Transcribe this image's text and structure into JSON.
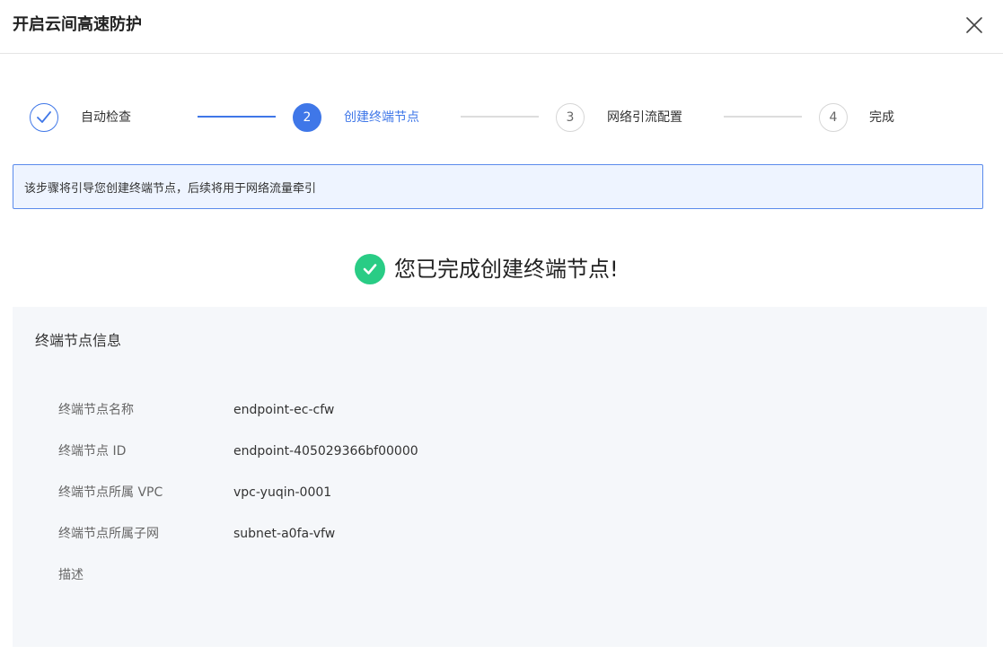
{
  "header": {
    "title": "开启云间高速防护",
    "close_icon": "close-icon"
  },
  "colors": {
    "primary": "#3f77e8",
    "success": "#29cc85",
    "banner_bg": "#eef4ff",
    "card_bg": "#f5f7fa"
  },
  "steps": [
    {
      "number": "",
      "label": "自动检查",
      "status": "done",
      "icon": "check-icon"
    },
    {
      "number": "2",
      "label": "创建终端节点",
      "status": "active"
    },
    {
      "number": "3",
      "label": "网络引流配置",
      "status": "todo"
    },
    {
      "number": "4",
      "label": "完成",
      "status": "todo"
    }
  ],
  "banner": {
    "text": "该步骤将引导您创建终端节点，后续将用于网络流量牵引"
  },
  "success": {
    "icon": "success-check-icon",
    "message": "您已完成创建终端节点!"
  },
  "info": {
    "title": "终端节点信息",
    "fields": [
      {
        "label": "终端节点名称",
        "value": "endpoint-ec-cfw"
      },
      {
        "label": "终端节点 ID",
        "value": "endpoint-405029366bf00000"
      },
      {
        "label": "终端节点所属 VPC",
        "value": "vpc-yuqin-0001"
      },
      {
        "label": "终端节点所属子网",
        "value": "subnet-a0fa-vfw"
      },
      {
        "label": "描述",
        "value": ""
      }
    ]
  }
}
